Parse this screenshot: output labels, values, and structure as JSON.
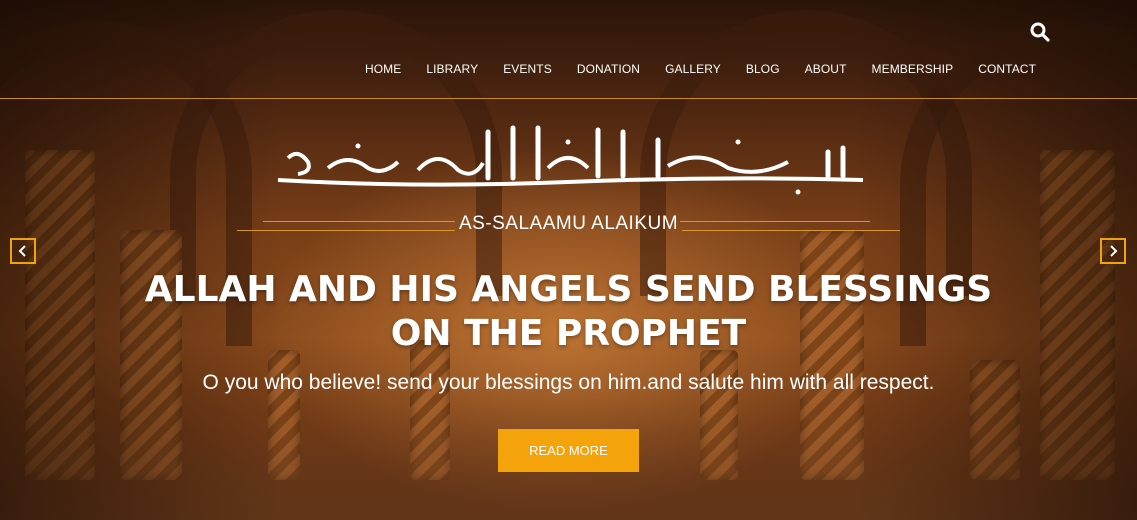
{
  "nav": {
    "items": [
      "HOME",
      "LIBRARY",
      "EVENTS",
      "DONATION",
      "GALLERY",
      "BLOG",
      "ABOUT",
      "MEMBERSHIP",
      "CONTACT"
    ]
  },
  "hero": {
    "greeting": "AS-SALAAMU ALAIKUM",
    "headline_line1": "ALLAH AND HIS ANGELS SEND BLESSINGS",
    "headline_line2": "ON THE PROPHET",
    "subtitle": "O you who believe! send your blessings on him.and salute him with all respect.",
    "button_label": "READ MORE",
    "calligraphy": "بسم الله الرحمن الرحيم"
  },
  "icons": {
    "search": "search-icon",
    "prev": "chevron-left-icon",
    "next": "chevron-right-icon"
  },
  "colors": {
    "accent": "#f5a30a",
    "line": "#c98a22"
  }
}
